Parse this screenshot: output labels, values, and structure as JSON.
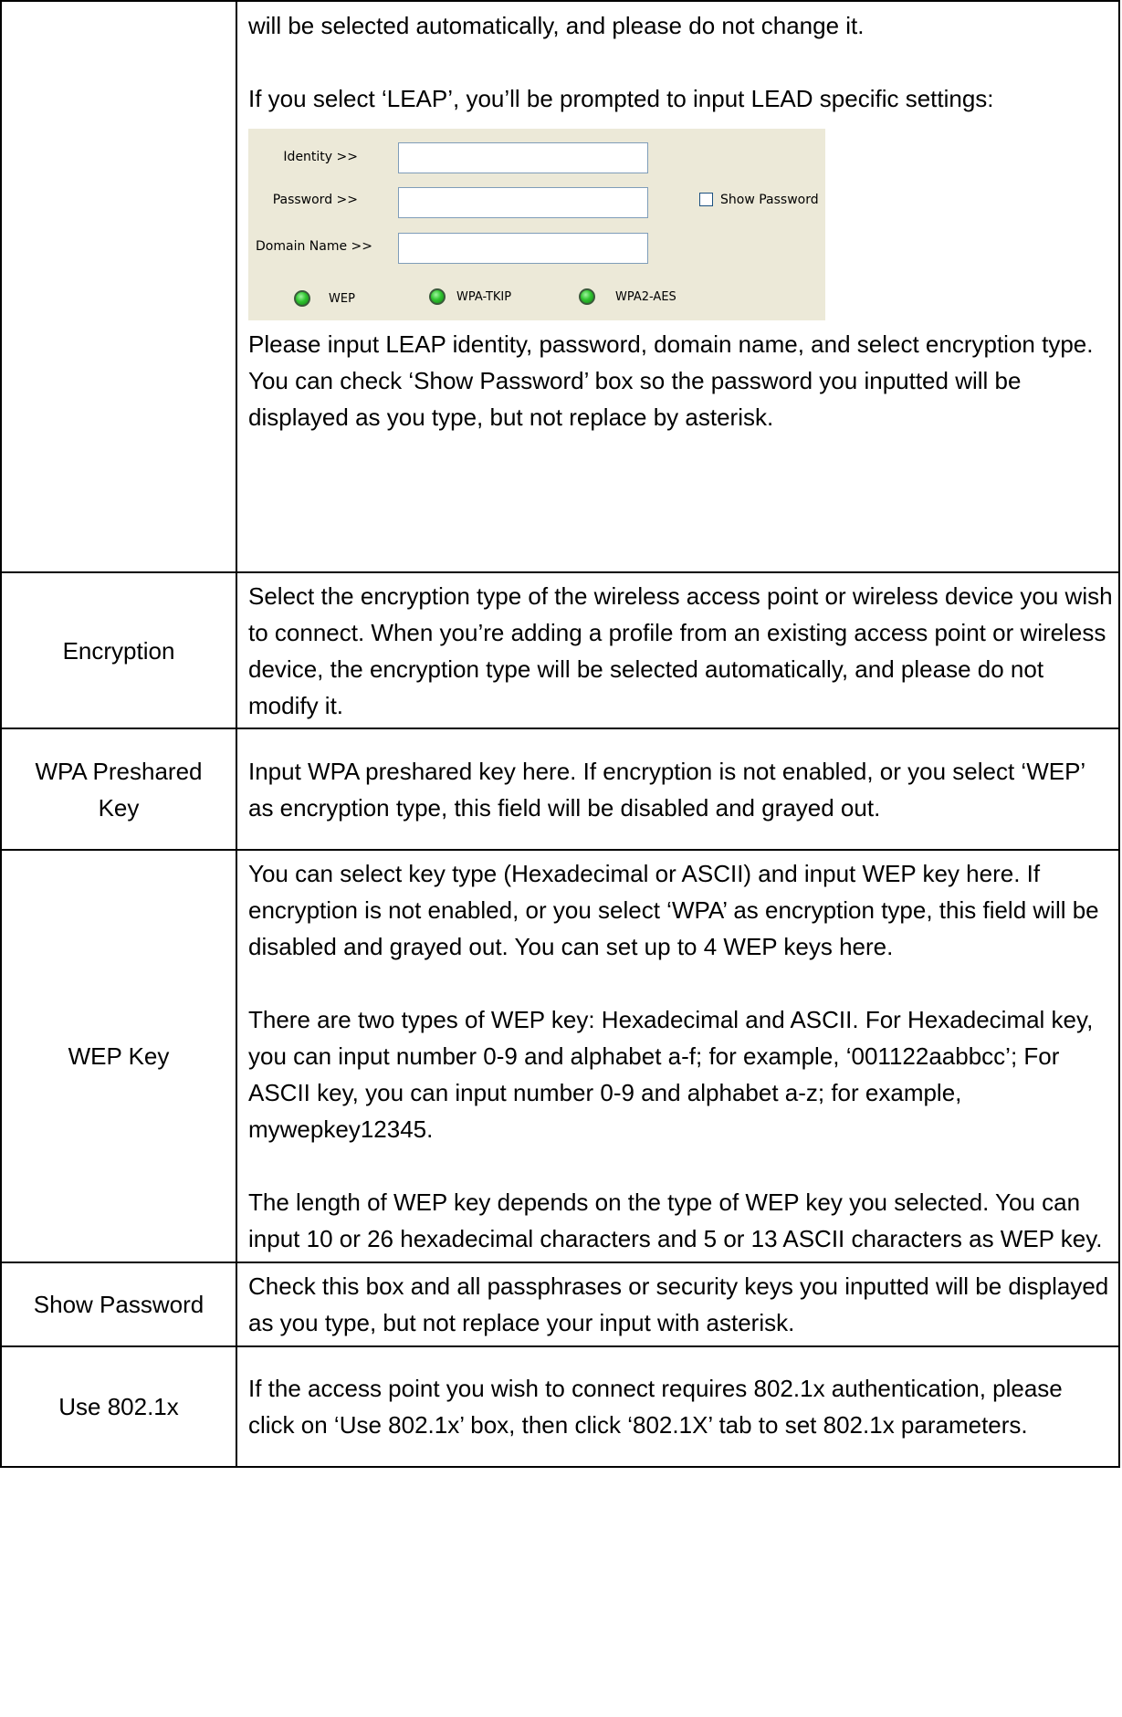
{
  "rows": [
    {
      "label": "",
      "paragraphs": [
        "will be selected automatically, and please do not change it.",
        "If you select ‘LEAP’, you’ll be prompted to input LEAD specific settings:",
        "Please input LEAP identity, password, domain name, and select encryption type. You can check ‘Show Password’ box so the password you inputted will be displayed as you type, but not replace by asterisk."
      ]
    },
    {
      "label": "Encryption",
      "paragraphs": [
        "Select the encryption type of the wireless access point or wireless device you wish to connect. When you’re adding a profile from an existing access point or wireless device, the encryption type will be selected automatically, and please do not modify it."
      ]
    },
    {
      "label": "WPA Preshared Key",
      "paragraphs": [
        "Input WPA preshared key here. If encryption is not enabled, or you select ‘WEP’ as encryption type, this field will be disabled and grayed out."
      ]
    },
    {
      "label": "WEP Key",
      "paragraphs": [
        "You can select key type (Hexadecimal or ASCII) and input WEP key here. If encryption is not enabled, or you select ‘WPA’ as encryption type, this field will be disabled and grayed out. You can set up to 4 WEP keys here.",
        "There are two types of WEP key: Hexadecimal and ASCII. For Hexadecimal key, you can input number 0-9 and alphabet a-f; for example, ‘001122aabbcc’; For ASCII key, you can input number 0-9 and alphabet a-z; for example, mywepkey12345.",
        "The length of WEP key depends on the type of WEP key you selected. You can input 10 or 26 hexadecimal characters and 5 or 13 ASCII characters as WEP key."
      ]
    },
    {
      "label": "Show Password",
      "paragraphs": [
        "Check this box and all passphrases or security keys you inputted will be displayed as you type, but not replace your input with asterisk."
      ]
    },
    {
      "label": "Use 802.1x",
      "paragraphs": [
        "If the access point you wish to connect requires 802.1x authentication, please click on ‘Use 802.1x’ box, then click ‘802.1X’ tab to set 802.1x parameters."
      ]
    }
  ],
  "leap_dialog": {
    "identity_label": "Identity >>",
    "password_label": "Password >>",
    "domain_label": "Domain Name >>",
    "identity_value": "",
    "password_value": "",
    "domain_value": "",
    "show_password_label": "Show Password",
    "show_password_checked": false,
    "encryption_options": [
      "WEP",
      "WPA-TKIP",
      "WPA2-AES"
    ],
    "radio_color": "#2fc42f"
  }
}
